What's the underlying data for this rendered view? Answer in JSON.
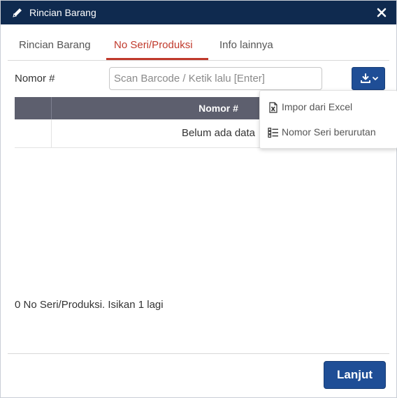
{
  "window": {
    "title": "Rincian Barang",
    "title_icon": "pencil-icon",
    "close_icon": "close-icon"
  },
  "tabs": [
    {
      "label": "Rincian Barang",
      "active": false
    },
    {
      "label": "No Seri/Produksi",
      "active": true
    },
    {
      "label": "Info lainnya",
      "active": false
    }
  ],
  "nomor": {
    "label": "Nomor #",
    "placeholder": "Scan Barcode / Ketik lalu [Enter]",
    "value": ""
  },
  "import_button": {
    "icon": "download-icon",
    "dropdown_icon": "chevron-down-icon"
  },
  "dropdown": {
    "items": [
      {
        "label": "Impor dari Excel",
        "icon": "excel-icon"
      },
      {
        "label": "Nomor Seri berurutan",
        "icon": "list-icon"
      }
    ]
  },
  "table": {
    "column_header": "Nomor #",
    "empty_text": "Belum ada data"
  },
  "status": {
    "text": "0 No Seri/Produksi. Isikan 1 lagi"
  },
  "footer": {
    "next_label": "Lanjut"
  },
  "colors": {
    "titlebar": "#0f2a4f",
    "accent": "#1f4e96",
    "active_tab": "#c0392b",
    "table_header": "#5d5f6e"
  }
}
